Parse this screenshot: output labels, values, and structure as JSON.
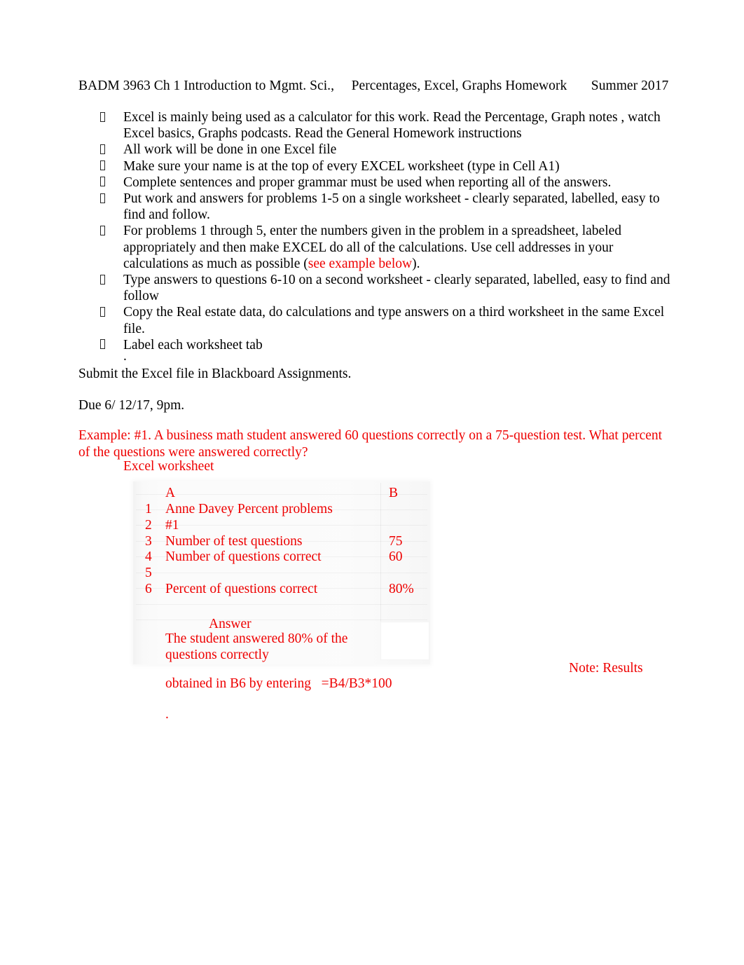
{
  "document": {
    "header": "BADM 3963 Ch 1 Introduction to Mgmt. Sci.,     Percentages, Excel, Graphs Homework       Summer 2017",
    "bullets": [
      "Excel is mainly being used as a calculator for this work. Read the Percentage, Graph notes , watch Excel basics, Graphs  podcasts.  Read the General Homework instructions",
      "All work will be done in one Excel file",
      "Make sure your name    is at the top of every EXCEL worksheet  (type in Cell A1)",
      "Complete sentences and proper grammar must be used when reporting all of the answers.",
      "Put work and answers for problems 1-5 on a single worksheet  -  clearly separated, labelled, easy to find and follow.",
      "Type answers to questions 6-10 on a second worksheet -  clearly separated, labelled, easy to find and follow",
      "Copy the Real estate data, do calculations and type answers on a third worksheet in the same Excel file.",
      "Label each worksheet tab"
    ],
    "bullet_with_link": {
      "before": "For problems 1 through 5, enter the numbers given in the problem in a spreadsheet, labeled appropriately and then make EXCEL do all of the calculations.  Use cell addresses in your calculations as much as possible (",
      "link": "see example below",
      "after": ")."
    },
    "stray_dot_after_list": ".",
    "submit_line": "Submit the Excel file in Blackboard Assignments.",
    "due_line": "Due 6/ 12/17, 9pm.",
    "example": {
      "line1": "Example:  #1. A business math student answered 60 questions correctly on a 75-question test.  What percent",
      "line2": "of the questions were answered correctly?",
      "worksheet_label": "Excel worksheet"
    },
    "worksheet": {
      "col_header_a": "A",
      "col_header_b": "B",
      "rows": [
        {
          "num": "1",
          "a": "Anne Davey Percent problems",
          "b": ""
        },
        {
          "num": "2",
          "a": "#1",
          "b": ""
        },
        {
          "num": "3",
          "a": "Number of test questions",
          "b": "75"
        },
        {
          "num": "4",
          "a": "Number of questions correct",
          "b": "60"
        },
        {
          "num": "5",
          "a": "",
          "b": ""
        },
        {
          "num": "6",
          "a": "Percent of questions correct",
          "b": "80%"
        }
      ],
      "answer_label": "Answer",
      "answer_text": "The student answered 80% of the questions correctly"
    },
    "note": {
      "right_fragment": "Note: Results",
      "continuation": "obtained in B6 by entering   =B4/B3*100",
      "trailing_dot": "."
    },
    "colors": {
      "red": "#ee0000",
      "black": "#000000",
      "page_background": "#ffffff"
    }
  }
}
